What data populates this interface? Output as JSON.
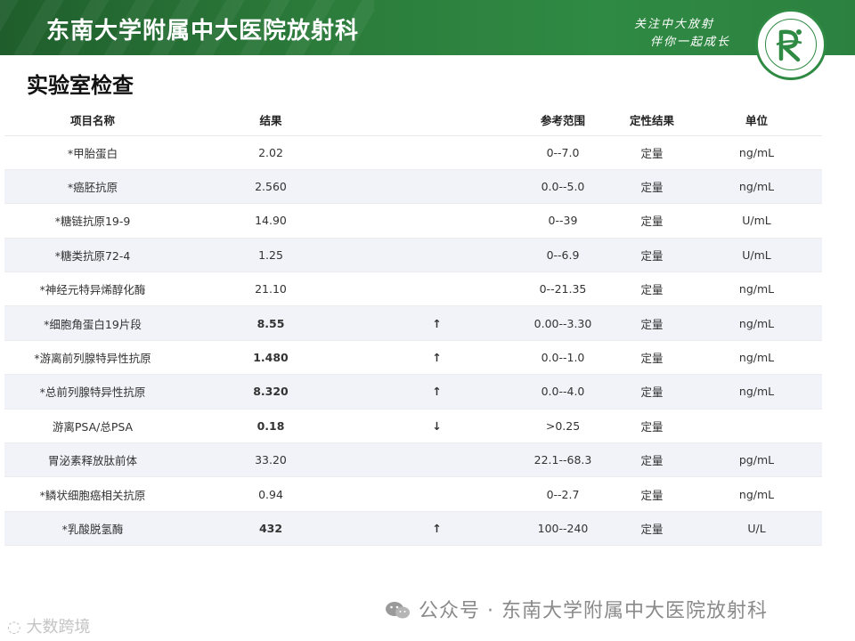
{
  "header": {
    "title": "东南大学附属中大医院放射科",
    "slogan_line1": "关注中大放射",
    "slogan_line2": "伴你一起成长"
  },
  "section_title": "实验室检查",
  "table": {
    "headers": [
      "项目名称",
      "结果",
      "",
      "参考范围",
      "定性结果",
      "单位"
    ],
    "rows": [
      {
        "name": "*甲胎蛋白",
        "result": "2.02",
        "flag": "",
        "ref": "0--7.0",
        "qual": "定量",
        "unit": "ng/mL",
        "status": "normal"
      },
      {
        "name": "*癌胚抗原",
        "result": "2.560",
        "flag": "",
        "ref": "0.0--5.0",
        "qual": "定量",
        "unit": "ng/mL",
        "status": "normal"
      },
      {
        "name": "*糖链抗原19-9",
        "result": "14.90",
        "flag": "",
        "ref": "0--39",
        "qual": "定量",
        "unit": "U/mL",
        "status": "normal"
      },
      {
        "name": "*糖类抗原72-4",
        "result": "1.25",
        "flag": "",
        "ref": "0--6.9",
        "qual": "定量",
        "unit": "U/mL",
        "status": "normal"
      },
      {
        "name": "*神经元特异烯醇化酶",
        "result": "21.10",
        "flag": "",
        "ref": "0--21.35",
        "qual": "定量",
        "unit": "ng/mL",
        "status": "normal"
      },
      {
        "name": "*细胞角蛋白19片段",
        "result": "8.55",
        "flag": "↑",
        "ref": "0.00--3.30",
        "qual": "定量",
        "unit": "ng/mL",
        "status": "high"
      },
      {
        "name": "*游离前列腺特异性抗原",
        "result": "1.480",
        "flag": "↑",
        "ref": "0.0--1.0",
        "qual": "定量",
        "unit": "ng/mL",
        "status": "high"
      },
      {
        "name": "*总前列腺特异性抗原",
        "result": "8.320",
        "flag": "↑",
        "ref": "0.0--4.0",
        "qual": "定量",
        "unit": "ng/mL",
        "status": "high"
      },
      {
        "name": "游离PSA/总PSA",
        "result": "0.18",
        "flag": "↓",
        "ref": ">0.25",
        "qual": "定量",
        "unit": "",
        "status": "low"
      },
      {
        "name": "胃泌素释放肽前体",
        "result": "33.20",
        "flag": "",
        "ref": "22.1--68.3",
        "qual": "定量",
        "unit": "pg/mL",
        "status": "normal"
      },
      {
        "name": "*鳞状细胞癌相关抗原",
        "result": "0.94",
        "flag": "",
        "ref": "0--2.7",
        "qual": "定量",
        "unit": "ng/mL",
        "status": "normal"
      },
      {
        "name": "*乳酸脱氢酶",
        "result": "432",
        "flag": "↑",
        "ref": "100--240",
        "qual": "定量",
        "unit": "U/L",
        "status": "high"
      }
    ]
  },
  "watermark": "公众号 · 东南大学附属中大医院放射科",
  "watermark2": "大数跨境",
  "colors": {
    "header_green": "#2b7a3a",
    "high": "#e8343c",
    "low": "#e8a020",
    "row_shade": "#f1f3f9"
  }
}
